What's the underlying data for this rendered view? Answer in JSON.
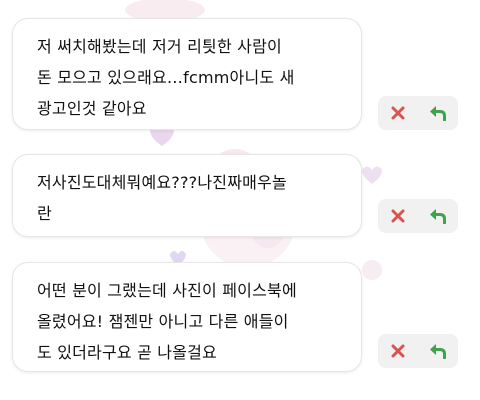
{
  "messages": [
    {
      "lines": [
        "저 써치해봤는데 저거 리틧한 사람이",
        "돈 모으고 있으래요…fcmm아니도 새",
        "광고인것 같아요"
      ]
    },
    {
      "lines": [
        "저사진도대체뭐예요???나진짜매우놀",
        "란"
      ]
    },
    {
      "lines": [
        "어떤 분이 그랬는데 사진이 페이스북에",
        "올렸어요! 잼젠만 아니고 다른 애들이",
        "도 있더라구요 곧 나올걸요"
      ]
    }
  ],
  "actions": {
    "reject_icon": "close-x-icon",
    "reply_icon": "reply-arrow-icon"
  },
  "colors": {
    "reject": "#d9534f",
    "reply": "#3fa34d",
    "action_bg": "#f1f1f1"
  }
}
